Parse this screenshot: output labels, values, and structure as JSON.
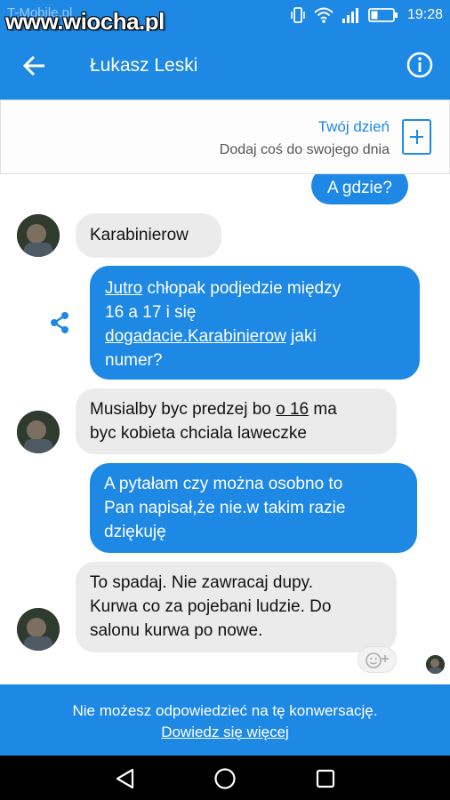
{
  "status_bar": {
    "carrier": "T-Mobile.pl",
    "watermark": "www.wiocha.pl",
    "time": "19:28"
  },
  "header": {
    "contact_name": "Łukasz Leski",
    "back_icon": "arrow-left-icon",
    "info_icon": "info-icon"
  },
  "story_banner": {
    "title": "Twój dzień",
    "subtitle": "Dodaj coś do swojego dnia",
    "add_icon": "plus-square-icon"
  },
  "messages": [
    {
      "direction": "out",
      "text": "A gdzie?"
    },
    {
      "direction": "in",
      "text": "Karabinierow"
    },
    {
      "direction": "out",
      "parts": [
        "Jutro",
        " chłopak podjedzie między",
        "16 a 17 i się",
        "dogadacie.Karabinierow",
        " jaki",
        "numer?"
      ]
    },
    {
      "direction": "in",
      "parts": [
        "Musialby byc predzej bo ",
        "o 16",
        " ma",
        "byc kobieta chciala laweczke"
      ]
    },
    {
      "direction": "out",
      "lines": [
        "A pytałam czy można osobno to",
        "Pan napisał,że nie.w takim razie",
        "dziękuję"
      ]
    },
    {
      "direction": "in",
      "lines": [
        "To spadaj. Nie zawracaj dupy.",
        "Kurwa co za pojebani ludzie. Do",
        "salonu kurwa po nowe."
      ]
    }
  ],
  "footer": {
    "notice": "Nie możesz odpowiedzieć na tę konwersację.",
    "link": "Dowiedz się więcej"
  },
  "colors": {
    "accent": "#1e88e5",
    "incoming_bubble": "#ebebeb",
    "navbar": "#000000"
  }
}
